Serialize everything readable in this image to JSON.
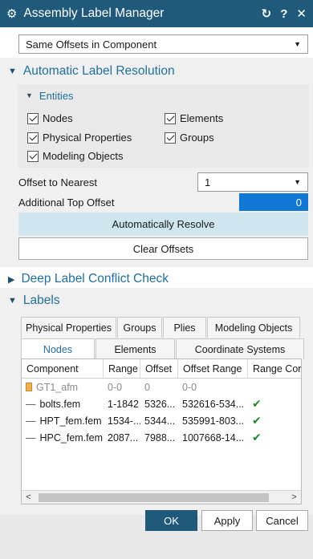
{
  "window": {
    "title": "Assembly Label Manager",
    "icon": "gear-icon",
    "controls": [
      "↻",
      "?",
      "✕"
    ]
  },
  "mode_select": {
    "value": "Same Offsets in Component"
  },
  "auto_section": {
    "title": "Automatic Label Resolution",
    "entities": {
      "title": "Entities",
      "checks": [
        "Nodes",
        "Elements",
        "Physical Properties",
        "Groups",
        "Modeling Objects"
      ]
    },
    "offset_nearest_label": "Offset to Nearest",
    "offset_nearest_value": "1",
    "top_offset_label": "Additional Top Offset",
    "top_offset_value": "0",
    "resolve_label": "Automatically Resolve",
    "clear_label": "Clear Offsets"
  },
  "deep_section": {
    "title": "Deep Label Conflict Check"
  },
  "labels_section": {
    "title": "Labels",
    "tabs_top": [
      "Physical Properties",
      "Groups",
      "Plies",
      "Modeling Objects"
    ],
    "tabs_bottom": [
      "Nodes",
      "Elements",
      "Coordinate Systems"
    ],
    "columns": [
      "Component",
      "Range",
      "Offset",
      "Offset Range",
      "Range Con"
    ],
    "rows": [
      {
        "component": "GT1_afm",
        "range": "0-0",
        "offset": "0",
        "offset_range": "0-0",
        "ok": ""
      },
      {
        "component": "bolts.fem",
        "range": "1-1842",
        "offset": "5326...",
        "offset_range": "532616-534...",
        "ok": "✔"
      },
      {
        "component": "HPT_fem.fem",
        "range": "1534-...",
        "offset": "5344...",
        "offset_range": "535991-803...",
        "ok": "✔"
      },
      {
        "component": "HPC_fem.fem",
        "range": "2087...",
        "offset": "7988...",
        "offset_range": "1007668-14...",
        "ok": "✔"
      }
    ]
  },
  "footer": {
    "ok": "OK",
    "apply": "Apply",
    "cancel": "Cancel"
  },
  "colors": {
    "titlebar": "#1f5a7a",
    "accent_text": "#1f6fa0",
    "selection": "#1177d4",
    "resolve_button": "#cfe6ef",
    "check_ok": "#1e8a2a"
  }
}
